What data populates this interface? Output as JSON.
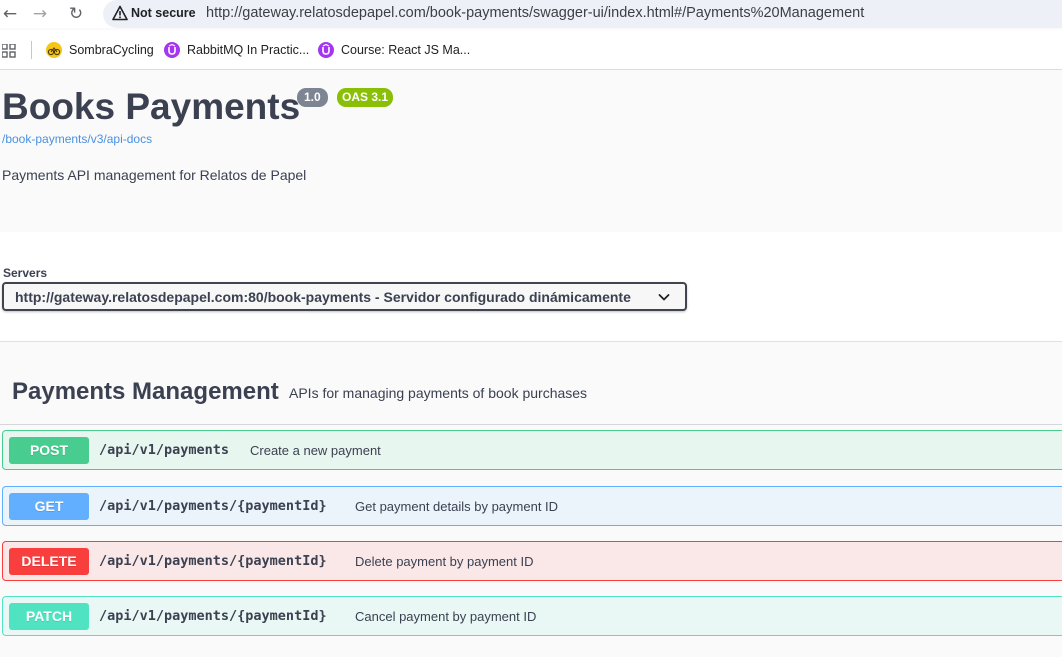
{
  "browser": {
    "security_label": "Not secure",
    "url": "http://gateway.relatosdepapel.com/book-payments/swagger-ui/index.html#/Payments%20Management",
    "bookmarks": [
      {
        "label": "SombraCycling",
        "icon": "cycling-icon"
      },
      {
        "label": "RabbitMQ In Practic...",
        "icon": "course-icon"
      },
      {
        "label": "Course: React JS Ma...",
        "icon": "course-icon"
      }
    ]
  },
  "info": {
    "title": "Books Payments",
    "version": "1.0",
    "oas": "OAS 3.1",
    "api_docs_link": "/book-payments/v3/api-docs",
    "description": "Payments API management for Relatos de Papel"
  },
  "servers": {
    "label": "Servers",
    "selected": "http://gateway.relatosdepapel.com:80/book-payments - Servidor configurado dinámicamente"
  },
  "tag": {
    "name": "Payments Management",
    "description": "APIs for managing payments of book purchases"
  },
  "operations": [
    {
      "method": "POST",
      "path": "/api/v1/payments",
      "summary": "Create a new payment"
    },
    {
      "method": "GET",
      "path": "/api/v1/payments/{paymentId}",
      "summary": "Get payment details by payment ID"
    },
    {
      "method": "DELETE",
      "path": "/api/v1/payments/{paymentId}",
      "summary": "Delete payment by payment ID"
    },
    {
      "method": "PATCH",
      "path": "/api/v1/payments/{paymentId}",
      "summary": "Cancel payment by payment ID"
    }
  ],
  "colors": {
    "post": "#49cc90",
    "get": "#61affe",
    "delete": "#f93e3e",
    "patch": "#50e3c2",
    "oas_badge": "#89bf04",
    "version_badge": "#7d8492"
  }
}
